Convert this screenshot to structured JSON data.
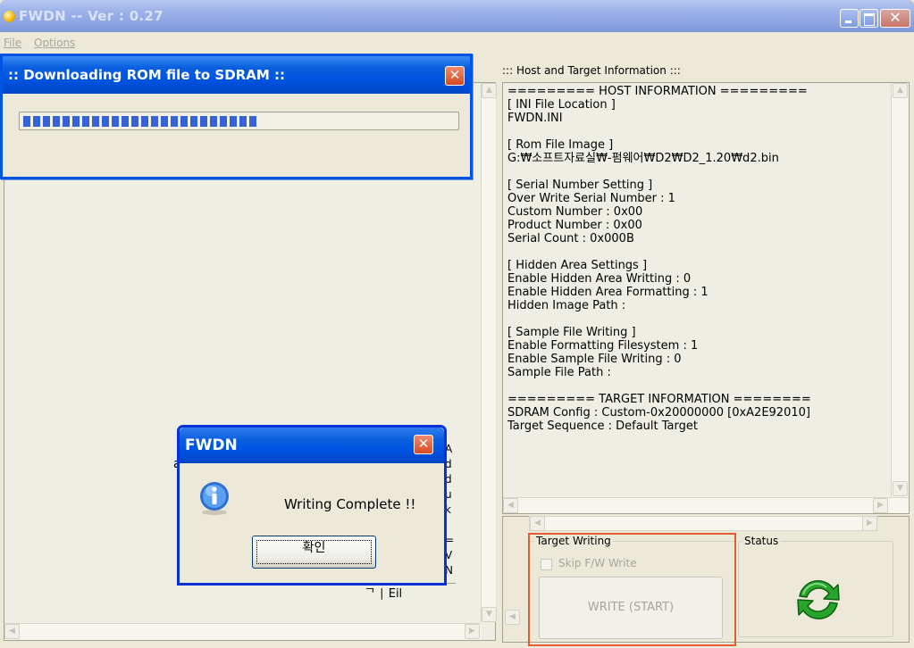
{
  "window": {
    "title": "FWDN -- Ver : 0.27"
  },
  "menu": {
    "file": "File",
    "options": "Options"
  },
  "progress_dialog": {
    "title": ":: Downloading ROM file to SDRAM ::",
    "progress_fraction": 0.55
  },
  "message_box": {
    "title": "FWDN",
    "text": "Writing Complete !!",
    "ok_label": "확인"
  },
  "right_panel": {
    "header": "::: Host and Target Information :::",
    "info_lines": [
      "========= HOST INFORMATION =========",
      "[ INI File Location ]",
      "FWDN.INI",
      "",
      "[ Rom File Image ]",
      "G:₩소프트자료실₩-펌웨어₩D2₩D2_1.20₩d2.bin",
      "",
      "[ Serial Number Setting ]",
      "Over Write Serial Number : 1",
      "Custom Number : 0x00",
      "Product Number : 0x00",
      "Serial Count : 0x000B",
      "",
      "[ Hidden Area Settings ]",
      "Enable Hidden Area Writting : 0",
      "Enable Hidden Area Formatting : 1",
      "Hidden Image Path :",
      "",
      "[ Sample File Writing ]",
      "Enable Formatting Filesystem : 1",
      "Enable Sample File Writing : 0",
      "Sample File Path :",
      "",
      "========= TARGET INFORMATION ========",
      "SDRAM Config : Custom-0x20000000 [0xA2E92010]",
      "Target Sequence : Default Target"
    ]
  },
  "target_writing": {
    "group_label": "Target Writing",
    "skip_label": "Skip F/W Write",
    "write_button": "WRITE (START)"
  },
  "status": {
    "group_label": "Status"
  },
  "colors": {
    "highlight_frame": "#E55B34",
    "status_arrows": "#27A52B"
  }
}
